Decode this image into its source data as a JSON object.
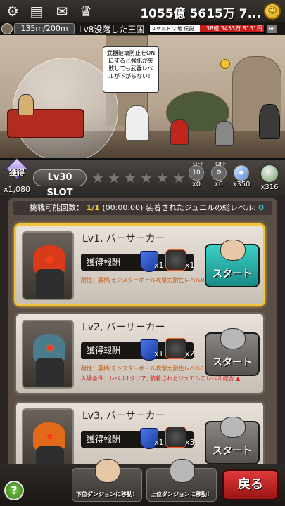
{
  "topbar": {
    "icons": [
      "gear-icon",
      "profile-card-icon",
      "mail-icon",
      "trophy-icon"
    ],
    "gold": "1055億 5615万 7...",
    "coin_symbol": "☺"
  },
  "status": {
    "distance": "135m/200m",
    "stage": "Lv8没落した王国",
    "enemy_name": "スケルトン  地  伝説",
    "enemy_hp": "38億 3453万 8151円",
    "enemy_hp_fraction": 0.56,
    "hp_tag": "HP"
  },
  "scene": {
    "tip_text": "武器破壊防止をONにすると強化が失敗しても武器レベルが下がらない！"
  },
  "slot": {
    "gain_label": "獲得",
    "gain_count": "x1,080",
    "slot_button": "Lv30 SLOT",
    "items": [
      {
        "icon": "ten-icon",
        "badge": "10",
        "count": "x0",
        "toggle": "OFF"
      },
      {
        "icon": "gear-small-icon",
        "badge": "",
        "count": "x0",
        "toggle": "OFF"
      },
      {
        "icon": "diamond-icon",
        "badge": "",
        "count": "x350",
        "toggle": ""
      }
    ],
    "right_count": "x316"
  },
  "panel": {
    "info_label": "挑戦可能回数：",
    "info_count": "1/1",
    "info_time": "(00:00:00)",
    "info_jewel_label": "装着されたジュエルの総レベル:",
    "info_jewel_value": "0"
  },
  "cards": [
    {
      "title": "Lv1, バーサーカー",
      "reward_label": "獲得報酬",
      "qty1": "x1",
      "qty2": "x1",
      "desc": "耐性：裏柄/モンスターボール攻撃力耐性レベル0",
      "cond": "",
      "start": "スタート",
      "crest_color": "#d83a1a"
    },
    {
      "title": "Lv2, バーサーカー",
      "reward_label": "獲得報酬",
      "qty1": "x1",
      "qty2": "x2",
      "desc": "耐性：裏柄/モンスターボール攻撃力耐性レベル1",
      "cond": "入場条件：レベル1クリア, 装着されたジュエルのレベル総合 ▲",
      "start": "スタート",
      "crest_color": "#4a7c8c"
    },
    {
      "title": "Lv3, バーサーカー",
      "reward_label": "獲得報酬",
      "qty1": "x1",
      "qty2": "x3",
      "desc": "",
      "cond": "",
      "start": "スタート",
      "crest_color": "#e06a1a"
    }
  ],
  "bottom": {
    "help": "?",
    "lower_dungeon": "下位ダンジョンに移動！",
    "upper_dungeon": "上位ダンジョンに移動！",
    "back": "戻る"
  }
}
